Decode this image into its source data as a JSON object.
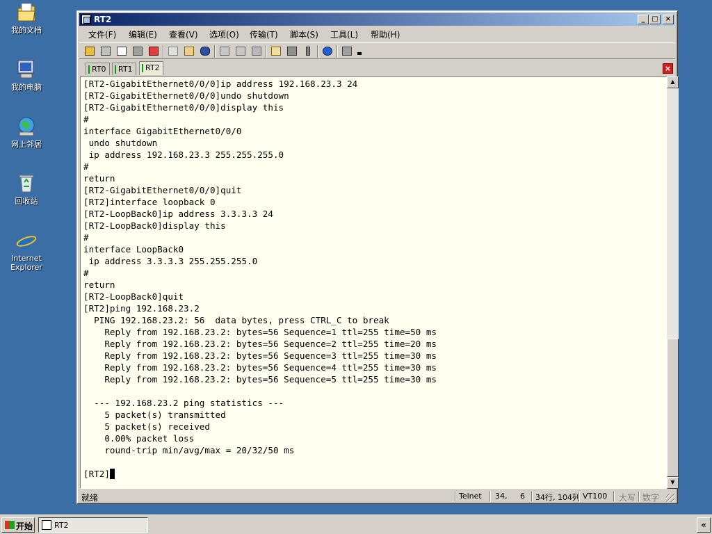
{
  "desktop": {
    "icons": [
      {
        "label": "我的文档",
        "icon": "my-documents-icon"
      },
      {
        "label": "我的电脑",
        "icon": "my-computer-icon"
      },
      {
        "label": "网上邻居",
        "icon": "network-places-icon"
      },
      {
        "label": "回收站",
        "icon": "recycle-bin-icon"
      },
      {
        "label": "Internet\nExplorer",
        "icon": "internet-explorer-icon"
      }
    ]
  },
  "window": {
    "title": "RT2",
    "minimize": "_",
    "maximize": "□",
    "close": "×"
  },
  "menu": [
    "文件(F)",
    "编辑(E)",
    "查看(V)",
    "选项(O)",
    "传输(T)",
    "脚本(S)",
    "工具(L)",
    "帮助(H)"
  ],
  "tabs": [
    {
      "label": "RT0",
      "active": false
    },
    {
      "label": "RT1",
      "active": false
    },
    {
      "label": "RT2",
      "active": true
    }
  ],
  "terminal": {
    "lines": [
      "[RT2-GigabitEthernet0/0/0]ip address 192.168.23.3 24",
      "[RT2-GigabitEthernet0/0/0]undo shutdown",
      "[RT2-GigabitEthernet0/0/0]display this",
      "#",
      "interface GigabitEthernet0/0/0",
      " undo shutdown",
      " ip address 192.168.23.3 255.255.255.0",
      "#",
      "return",
      "[RT2-GigabitEthernet0/0/0]quit",
      "[RT2]interface loopback 0",
      "[RT2-LoopBack0]ip address 3.3.3.3 24",
      "[RT2-LoopBack0]display this",
      "#",
      "interface LoopBack0",
      " ip address 3.3.3.3 255.255.255.0",
      "#",
      "return",
      "[RT2-LoopBack0]quit",
      "[RT2]ping 192.168.23.2",
      "  PING 192.168.23.2: 56  data bytes, press CTRL_C to break",
      "    Reply from 192.168.23.2: bytes=56 Sequence=1 ttl=255 time=50 ms",
      "    Reply from 192.168.23.2: bytes=56 Sequence=2 ttl=255 time=20 ms",
      "    Reply from 192.168.23.2: bytes=56 Sequence=3 ttl=255 time=30 ms",
      "    Reply from 192.168.23.2: bytes=56 Sequence=4 ttl=255 time=30 ms",
      "    Reply from 192.168.23.2: bytes=56 Sequence=5 ttl=255 time=30 ms",
      "",
      "  --- 192.168.23.2 ping statistics ---",
      "    5 packet(s) transmitted",
      "    5 packet(s) received",
      "    0.00% packet loss",
      "    round-trip min/avg/max = 20/32/50 ms",
      ""
    ],
    "prompt": "[RT2]"
  },
  "status": {
    "ready": "就绪",
    "protocol": "Telnet",
    "row": "34,",
    "col": "6",
    "size": "34行, 104列",
    "emulation": "VT100",
    "caps": "大写",
    "num": "数字"
  },
  "taskbar": {
    "start": "开始",
    "task": "RT2",
    "tray": "«"
  }
}
